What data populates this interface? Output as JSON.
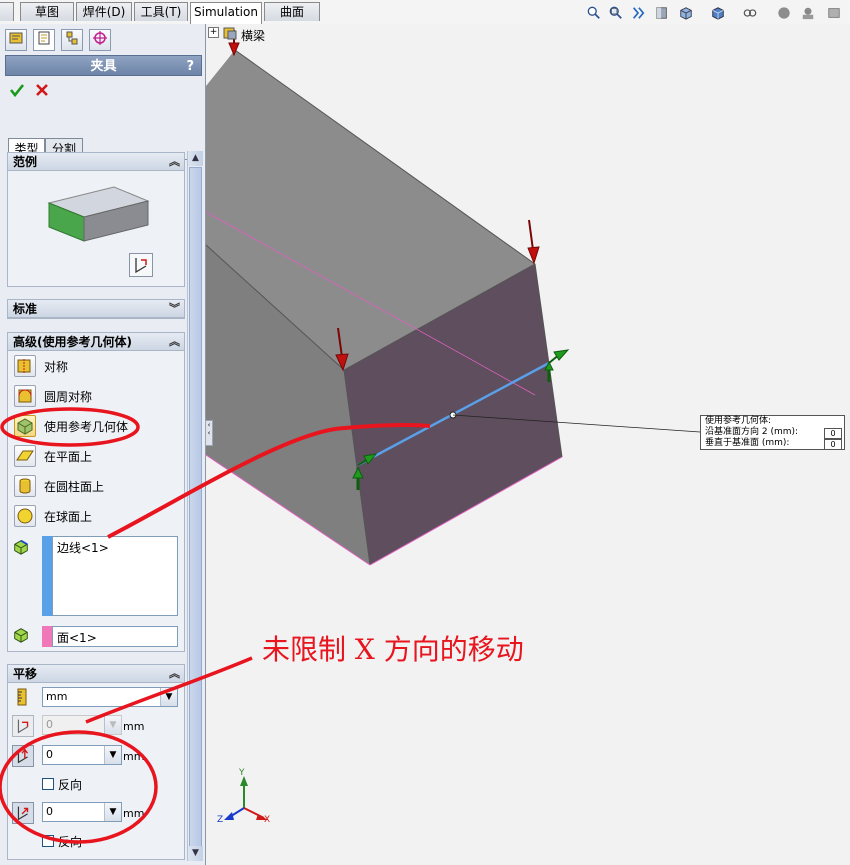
{
  "command_tabs": [
    "草图",
    "焊件(D)",
    "工具(T)",
    "Simulation",
    "曲面"
  ],
  "active_tab": "Simulation",
  "feature_tree": {
    "expand": "+",
    "root_label": "横梁"
  },
  "property_manager": {
    "title": "夹具",
    "help": "?",
    "ok_icon": "checkmark-icon",
    "cancel_icon": "x-icon",
    "tabs": [
      "类型",
      "分割"
    ],
    "active_tab": "类型",
    "example_group": {
      "title": "范例"
    },
    "standard_group": {
      "title": "标准"
    },
    "advanced_group": {
      "title": "高级(使用参考几何体)",
      "options": [
        "对称",
        "圆周对称",
        "使用参考几何体",
        "在平面上",
        "在圆柱面上",
        "在球面上"
      ],
      "selected": "使用参考几何体",
      "faces_edges": "边线<1>",
      "reference": "面<1>"
    },
    "translation_group": {
      "title": "平移",
      "unit": "mm",
      "dir1_value": "0",
      "dir2_value": "0",
      "dir3_value": "0",
      "unit_label": "mm",
      "reverse_label": "反向"
    }
  },
  "callout": {
    "title": "使用参考几何体:",
    "rows": [
      {
        "label": "沿基准面方向 2 (mm):",
        "value": "0"
      },
      {
        "label": "垂直于基准面 (mm):",
        "value": "0"
      }
    ]
  },
  "annotation_text": "未限制 X 方向的移动",
  "triad_labels": {
    "x": "X",
    "y": "Y",
    "z": "Z"
  },
  "colors": {
    "annotation_red": "#e8141e",
    "selected_edge": "#5aa0e8",
    "face": "#5e4e5e",
    "body": "#9a9a9a"
  }
}
